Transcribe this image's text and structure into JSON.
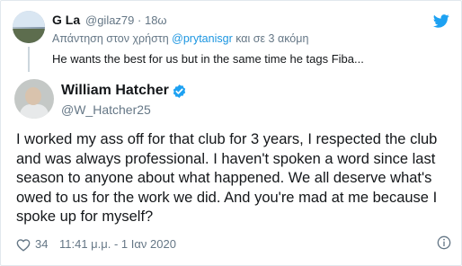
{
  "reply_tweet": {
    "name": "G La",
    "handle": "@gilaz79",
    "time": "18ω",
    "replying_prefix": "Απάντηση στον χρήστη ",
    "replying_link": "@prytanisgr",
    "replying_suffix": " και σε 3 ακόμη",
    "text": "He wants the best for us but in the same time he tags Fiba..."
  },
  "main_tweet": {
    "name": "William Hatcher",
    "handle": "@W_Hatcher25",
    "text": "I worked my ass off for that club for 3 years, I respected the club and was always professional. I haven't spoken a word since last season to anyone about what happened. We all deserve what's owed to us for the work we did. And you're mad at me because I spoke up for myself?",
    "likes": "34",
    "timestamp": "11:41 μ.μ. - 1 Ιαν 2020"
  },
  "icons": {
    "brand": "twitter-bird-icon",
    "verified": "verified-badge-icon",
    "like": "heart-icon",
    "info": "info-icon"
  },
  "colors": {
    "brand_blue": "#1da1f2",
    "link_blue": "#1b95e0",
    "secondary_text": "#657786",
    "primary_text": "#14171a",
    "border": "#e1e8ed"
  }
}
